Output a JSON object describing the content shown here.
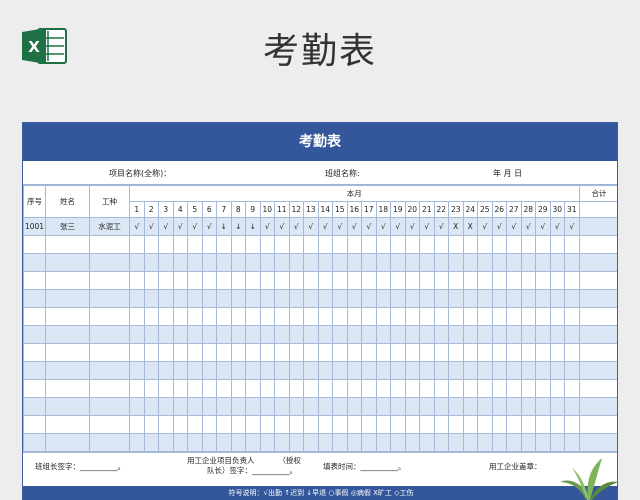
{
  "page_title": "考勤表",
  "sheet": {
    "title": "考勤表",
    "project_label": "项目名称(全称)：",
    "team_label": "班组名称:",
    "date_label": "年    月    日",
    "columns": {
      "seq": "序号",
      "name": "姓名",
      "trade": "工种",
      "month": "本月",
      "total": "合计"
    },
    "days": [
      "1",
      "2",
      "3",
      "4",
      "5",
      "6",
      "7",
      "8",
      "9",
      "10",
      "11",
      "12",
      "13",
      "14",
      "15",
      "16",
      "17",
      "18",
      "19",
      "20",
      "21",
      "22",
      "23",
      "24",
      "25",
      "26",
      "27",
      "28",
      "29",
      "30",
      "31"
    ],
    "rows": [
      {
        "seq": "1001",
        "name": "张三",
        "trade": "水泥工",
        "marks": [
          "√",
          "√",
          "√",
          "√",
          "√",
          "√",
          "↓",
          "↓",
          "↓",
          "√",
          "√",
          "√",
          "√",
          "√",
          "√",
          "√",
          "√",
          "√",
          "√",
          "√",
          "√",
          "√",
          "X",
          "X",
          "√",
          "√",
          "√",
          "√",
          "√",
          "√",
          "√"
        ],
        "total": ""
      }
    ],
    "empty_row_count": 12,
    "footer": {
      "leader_sign": "班组长签字：",
      "company_manager_line1": "用工企业项目负责人",
      "company_manager_auth": "（授权",
      "company_manager_line2": "队长）签字：",
      "fill_time": "填表时间：",
      "company_seal": "用工企业盖章："
    },
    "legend": "符号说明：√出勤  ↑迟到  ↓早退  ○事假  ◎病假  X旷工  ◇工伤"
  }
}
